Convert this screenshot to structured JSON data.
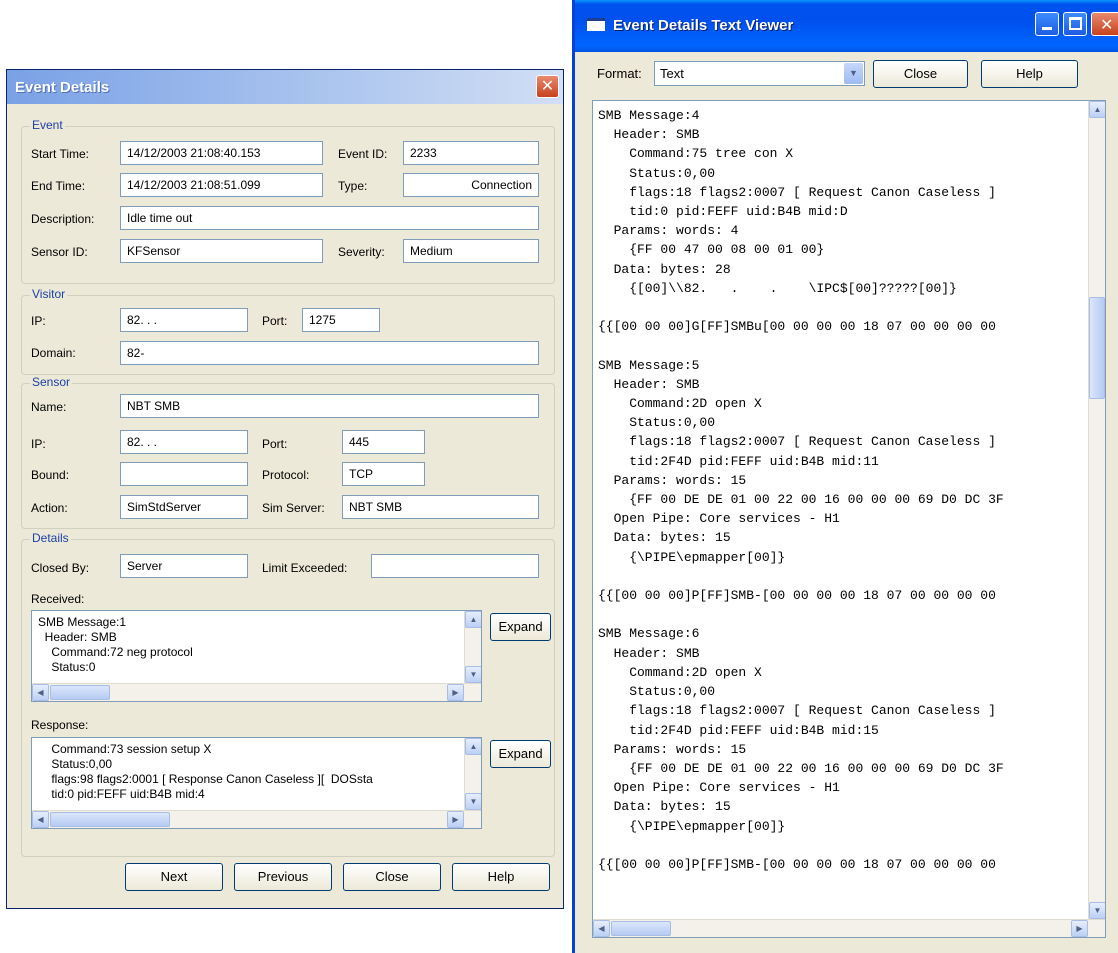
{
  "event_details": {
    "title": "Event Details",
    "close_glyph": "✕",
    "event": {
      "legend": "Event",
      "start_time_label": "Start Time:",
      "start_time": "14/12/2003 21:08:40.153",
      "event_id_label": "Event ID:",
      "event_id": "2233",
      "end_time_label": "End Time:",
      "end_time": "14/12/2003 21:08:51.099",
      "type_label": "Type:",
      "type": "Connection",
      "description_label": "Description:",
      "description": "Idle time out",
      "sensor_id_label": "Sensor ID:",
      "sensor_id": "KFSensor",
      "severity_label": "Severity:",
      "severity": "Medium"
    },
    "visitor": {
      "legend": "Visitor",
      "ip_label": "IP:",
      "ip": "82.   .    .",
      "port_label": "Port:",
      "port": "1275",
      "domain_label": "Domain:",
      "domain": "82-"
    },
    "sensor": {
      "legend": "Sensor",
      "name_label": "Name:",
      "name": "NBT SMB",
      "ip_label": "IP:",
      "ip": "82.   .    .",
      "port_label": "Port:",
      "port": "445",
      "bound_label": "Bound:",
      "bound": "",
      "protocol_label": "Protocol:",
      "protocol": "TCP",
      "action_label": "Action:",
      "action": "SimStdServer",
      "sim_server_label": "Sim Server:",
      "sim_server": "NBT SMB"
    },
    "details": {
      "legend": "Details",
      "closed_by_label": "Closed By:",
      "closed_by": "Server",
      "limit_exceeded_label": "Limit Exceeded:",
      "limit_exceeded": "",
      "received_label": "Received:",
      "received_text": "SMB Message:1\n  Header: SMB\n    Command:72 neg protocol\n    Status:0",
      "response_label": "Response:",
      "response_text": "    Command:73 session setup X\n    Status:0,00\n    flags:98 flags2:0001 [ Response Canon Caseless ][  DOSsta\n    tid:0 pid:FEFF uid:B4B mid:4",
      "expand_label": "Expand"
    },
    "buttons": {
      "next": "Next",
      "previous": "Previous",
      "close": "Close",
      "help": "Help"
    }
  },
  "text_viewer": {
    "title": "Event Details Text Viewer",
    "format_label": "Format:",
    "format_value": "Text",
    "close_button": "Close",
    "help_button": "Help",
    "content": "SMB Message:4\n  Header: SMB\n    Command:75 tree con X\n    Status:0,00\n    flags:18 flags2:0007 [ Request Canon Caseless ]\n    tid:0 pid:FEFF uid:B4B mid:D\n  Params: words: 4\n    {FF 00 47 00 08 00 01 00}\n  Data: bytes: 28\n    {[00]\\\\82.   .    .    \\IPC$[00]?????[00]}\n\n{{[00 00 00]G[FF]SMBu[00 00 00 00 18 07 00 00 00 00\n\nSMB Message:5\n  Header: SMB\n    Command:2D open X\n    Status:0,00\n    flags:18 flags2:0007 [ Request Canon Caseless ]\n    tid:2F4D pid:FEFF uid:B4B mid:11\n  Params: words: 15\n    {FF 00 DE DE 01 00 22 00 16 00 00 00 69 D0 DC 3F\n  Open Pipe: Core services - H1\n  Data: bytes: 15\n    {\\PIPE\\epmapper[00]}\n\n{{[00 00 00]P[FF]SMB-[00 00 00 00 18 07 00 00 00 00\n\nSMB Message:6\n  Header: SMB\n    Command:2D open X\n    Status:0,00\n    flags:18 flags2:0007 [ Request Canon Caseless ]\n    tid:2F4D pid:FEFF uid:B4B mid:15\n  Params: words: 15\n    {FF 00 DE DE 01 00 22 00 16 00 00 00 69 D0 DC 3F\n  Open Pipe: Core services - H1\n  Data: bytes: 15\n    {\\PIPE\\epmapper[00]}\n\n{{[00 00 00]P[FF]SMB-[00 00 00 00 18 07 00 00 00 00"
  },
  "colors": {
    "window_bg": "#ece9d8",
    "inactive_title": "#a9c3ee",
    "active_title": "#0050ee",
    "group_label": "#1c3fa8",
    "field_border": "#7f9db9"
  }
}
